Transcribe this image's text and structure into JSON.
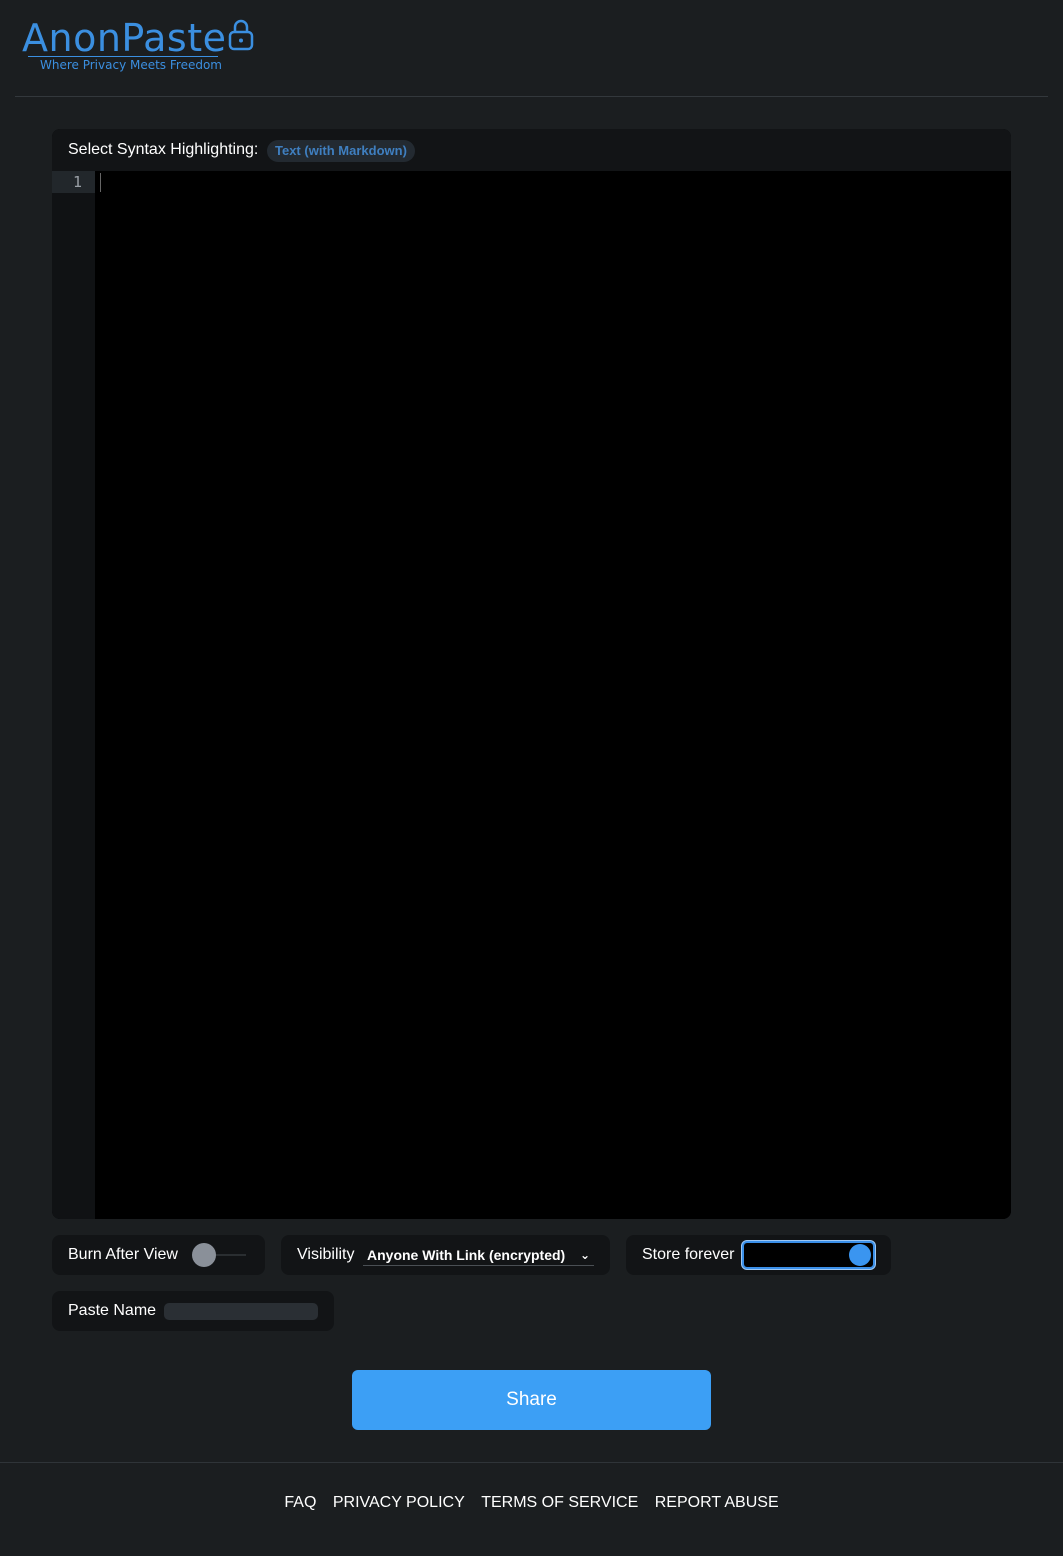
{
  "brand": {
    "name": "AnonPaste",
    "tagline": "Where Privacy Meets Freedom",
    "color": "#3b8fe0",
    "icon": "lock-icon"
  },
  "editor": {
    "syntax_label": "Select Syntax Highlighting:",
    "syntax_value": "Text (with Markdown)",
    "line_numbers": [
      "1"
    ],
    "content": ""
  },
  "options": {
    "burn_after_view": {
      "label": "Burn After View",
      "enabled": false
    },
    "visibility": {
      "label": "Visibility",
      "value": "Anyone With Link (encrypted)"
    },
    "store_forever": {
      "label": "Store forever",
      "enabled": true
    },
    "paste_name": {
      "label": "Paste Name",
      "value": ""
    }
  },
  "actions": {
    "share_label": "Share",
    "accent": "#3c9ff5"
  },
  "footer": {
    "links": [
      "FAQ",
      "PRIVACY POLICY",
      "TERMS OF SERVICE",
      "REPORT ABUSE"
    ]
  }
}
